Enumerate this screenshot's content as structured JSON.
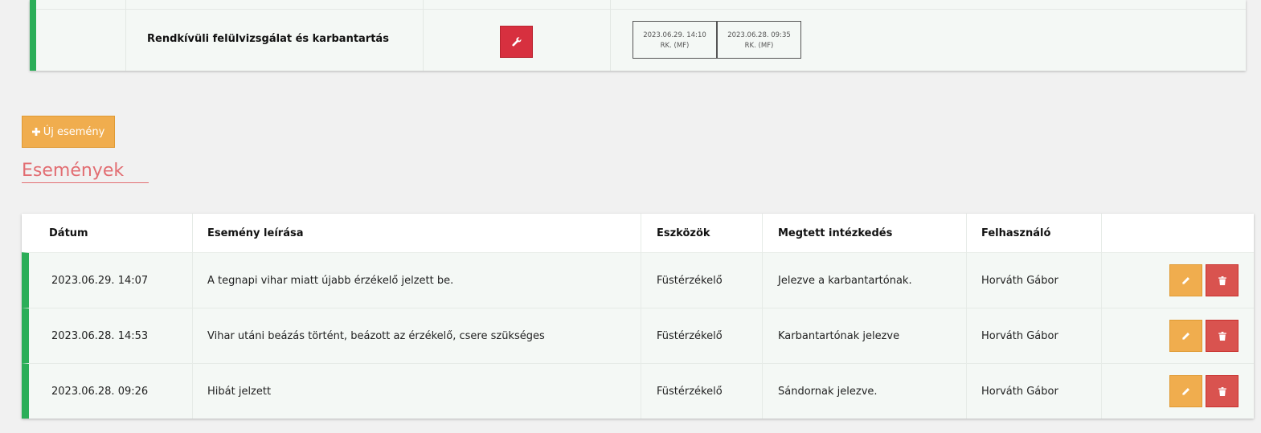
{
  "maintenance": {
    "title": "Rendkívüli felülvizsgálat és karbantartás",
    "stamps": [
      {
        "date": "2023.06.29. 14:10",
        "label": "RK. (MF)"
      },
      {
        "date": "2023.06.28. 09:35",
        "label": "RK. (MF)"
      }
    ]
  },
  "new_event_label": "Új esemény",
  "section_title": "Események",
  "table": {
    "headers": {
      "date": "Dátum",
      "description": "Esemény leírása",
      "devices": "Eszközök",
      "action": "Megtett intézkedés",
      "user": "Felhasználó"
    },
    "rows": [
      {
        "date": "2023.06.29. 14:07",
        "description": "A tegnapi vihar miatt újabb érzékelő jelzett be.",
        "devices": "Füstérzékelő",
        "action": "Jelezve a karbantartónak.",
        "user": "Horváth Gábor"
      },
      {
        "date": "2023.06.28. 14:53",
        "description": "Vihar utáni beázás történt, beázott az érzékelő, csere szükséges",
        "devices": "Füstérzékelő",
        "action": "Karbantartónak jelezve",
        "user": "Horváth Gábor"
      },
      {
        "date": "2023.06.28. 09:26",
        "description": "Hibát jelzett",
        "devices": "Füstérzékelő",
        "action": "Sándornak jelezve.",
        "user": "Horváth Gábor"
      }
    ]
  },
  "colors": {
    "status_green": "#2bae58",
    "warning_orange": "#f0ad4e",
    "danger_red": "#d9534f",
    "heading_pink": "#e26d72"
  },
  "icons": {
    "maintenance_button": "wrench-icon",
    "new_event": "plus-icon",
    "edit": "pencil-icon",
    "delete": "trash-icon"
  }
}
